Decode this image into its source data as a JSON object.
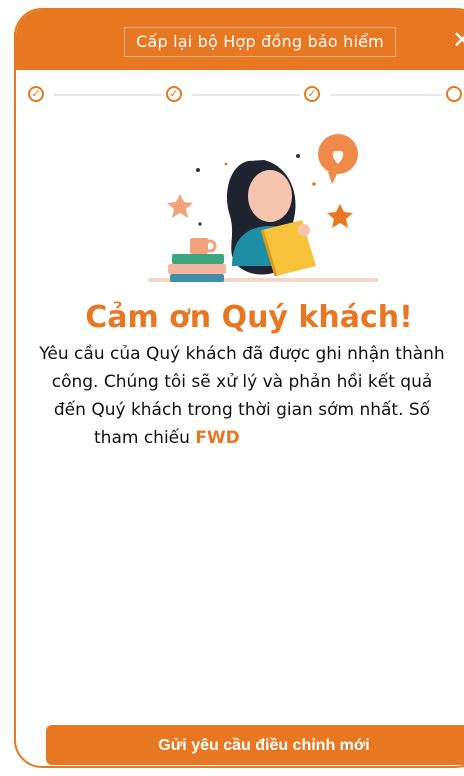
{
  "header": {
    "title": "Cấp lại bộ Hợp đồng bảo hiểm",
    "close_icon": "close-icon"
  },
  "stepper": {
    "steps": [
      "check-circle-icon",
      "check-circle-icon",
      "check-circle-icon",
      "circle-icon"
    ]
  },
  "content": {
    "heading": "Cảm ơn Quý khách!",
    "message_line_1": "Yêu cầu của Quý khách đã được ghi nhận thành",
    "message_line_2": "công. Chúng tôi sẽ xử lý và phản hồi kết quả",
    "message_line_3": "đến Quý khách trong thời gian sớm nhất. Số",
    "message_line_4_prefix": "tham chiếu",
    "reference_label": "FWD"
  },
  "actions": {
    "submit_new_request_label": "Gửi yêu cầu điều chỉnh mới"
  },
  "colors": {
    "accent": "#e87722",
    "text": "#111111"
  }
}
